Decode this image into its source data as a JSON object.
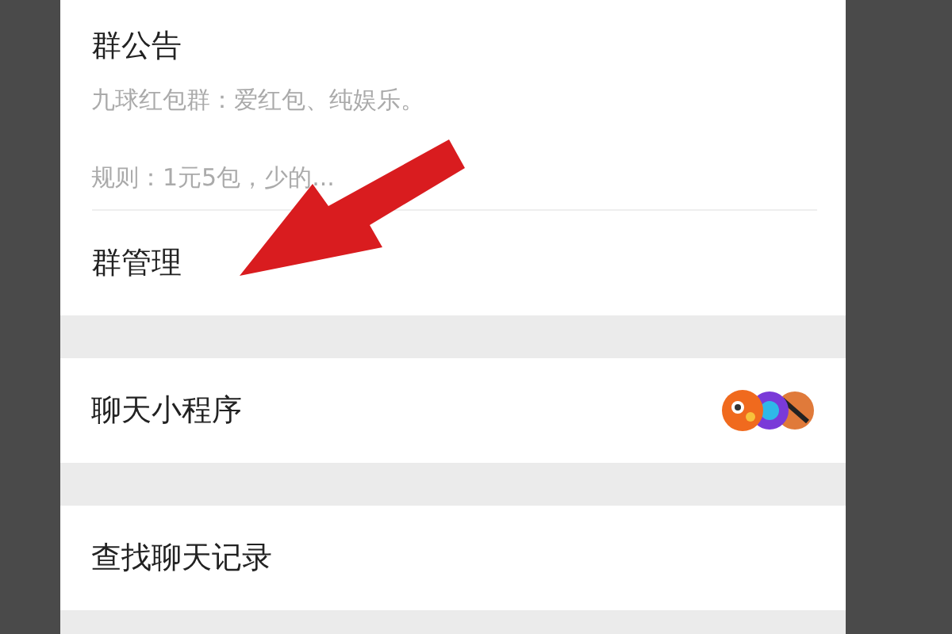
{
  "announcement": {
    "title": "群公告",
    "lines": [
      "九球红包群：爱红包、纯娱乐。",
      "规则：1元5包，少的..."
    ]
  },
  "menu_items": [
    {
      "label": "群管理",
      "kind": "plain"
    },
    {
      "label": "聊天小程序",
      "kind": "apps"
    },
    {
      "label": "查找聊天记录",
      "kind": "plain"
    }
  ]
}
